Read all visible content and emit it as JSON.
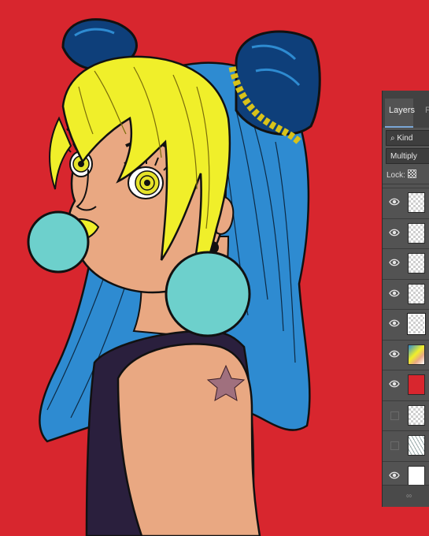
{
  "colors": {
    "background": "#d8262e",
    "hair": "#2e8bd1",
    "blonde": "#f0ef2a",
    "skin": "#e9a882",
    "earring": "#6dd0cc",
    "top": "#2a1f3d",
    "tattoo": "#a0707e"
  },
  "layers_panel": {
    "tabs": [
      {
        "label": "Layers",
        "active": true
      },
      {
        "label": "P",
        "active": false
      }
    ],
    "filter": {
      "icon": "search-icon",
      "label": "Kind"
    },
    "blend_mode": "Multiply",
    "lock_label": "Lock:",
    "layers": [
      {
        "visible": true,
        "thumb": "transparent",
        "selected": false
      },
      {
        "visible": true,
        "thumb": "transparent",
        "selected": false
      },
      {
        "visible": true,
        "thumb": "transparent",
        "selected": false
      },
      {
        "visible": true,
        "thumb": "transparent",
        "selected": false
      },
      {
        "visible": true,
        "thumb": "lineart",
        "selected": true
      },
      {
        "visible": true,
        "thumb": "colored",
        "selected": false
      },
      {
        "visible": true,
        "thumb": "red",
        "selected": false
      },
      {
        "visible": false,
        "thumb": "transparent",
        "selected": false
      },
      {
        "visible": false,
        "thumb": "sketch",
        "selected": false
      },
      {
        "visible": true,
        "thumb": "white",
        "selected": false
      }
    ],
    "footer_icon": "link-icon"
  }
}
